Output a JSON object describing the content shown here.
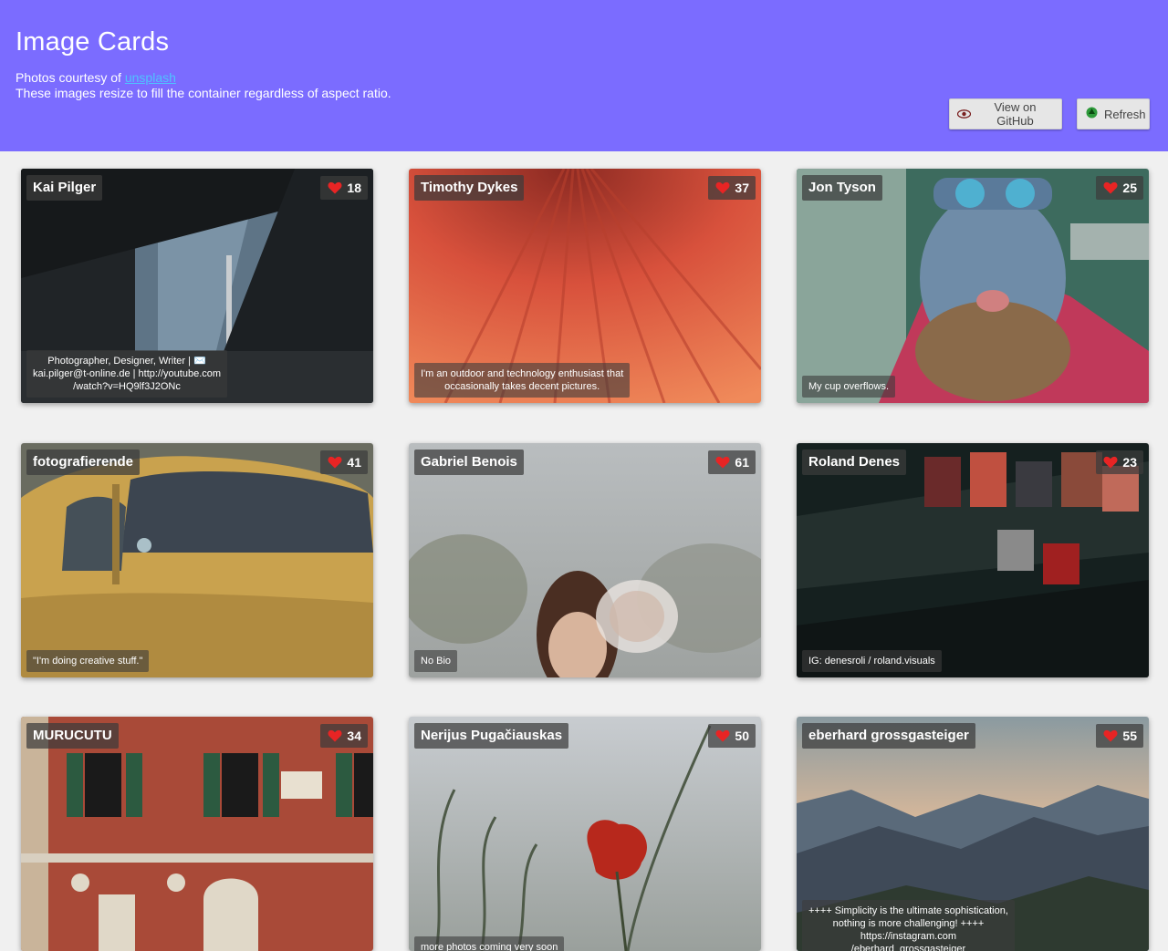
{
  "header": {
    "title": "Image Cards",
    "subtitle_prefix": "Photos courtesy of ",
    "subtitle_link": "unsplash",
    "subtitle_line2": "These images resize to fill the container regardless of aspect ratio.",
    "github_label": "View on GitHub",
    "refresh_label": "Refresh",
    "background": "#7b6cff",
    "link_color": "#4fc3ff"
  },
  "cards": [
    {
      "name": "Kai Pilger",
      "likes": "18",
      "bio": "Photographer, Designer, Writer | ✉️\nkai.pilger@t-online.de | http://youtube.com\n/watch?v=HQ9lf3J2ONc"
    },
    {
      "name": "Timothy Dykes",
      "likes": "37",
      "bio": "I'm an outdoor and technology enthusiast that\noccasionally takes decent pictures."
    },
    {
      "name": "Jon Tyson",
      "likes": "25",
      "bio": "My cup overflows."
    },
    {
      "name": "fotografierende",
      "likes": "41",
      "bio": "\"I'm doing creative stuff.\""
    },
    {
      "name": "Gabriel Benois",
      "likes": "61",
      "bio": "No Bio"
    },
    {
      "name": "Roland Denes",
      "likes": "23",
      "bio": "IG: denesroli / roland.visuals"
    },
    {
      "name": "MURUCUTU",
      "likes": "34",
      "bio": ""
    },
    {
      "name": "Nerijus Pugačiauskas",
      "likes": "50",
      "bio": "more photos coming very soon"
    },
    {
      "name": "eberhard grossgasteiger",
      "likes": "55",
      "bio": "++++ Simplicity is the ultimate sophistication,\nnothing is more challenging! ++++\nhttps://instagram.com\n/eberhard_grossgasteiger"
    }
  ]
}
